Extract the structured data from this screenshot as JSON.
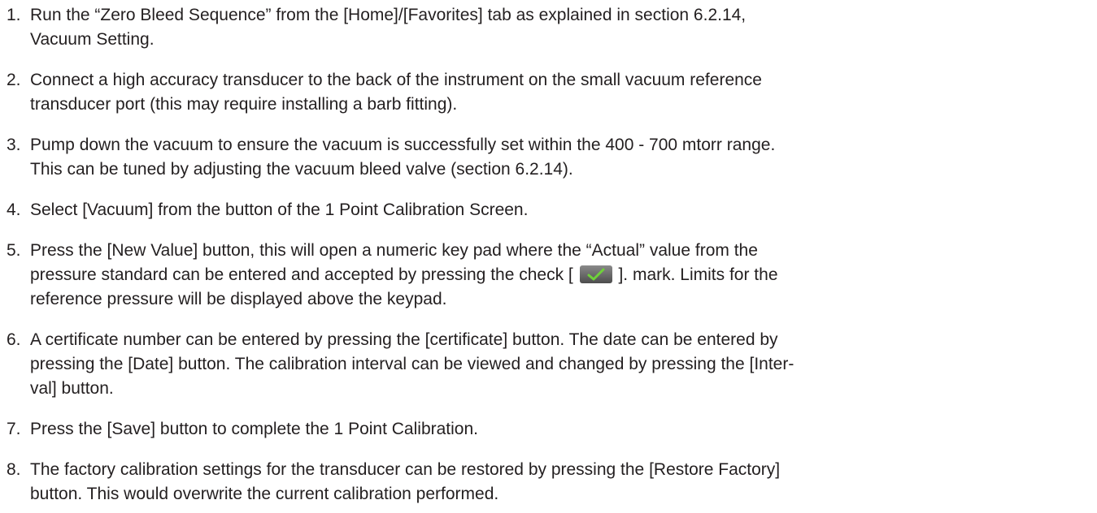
{
  "steps": [
    {
      "number": "1.",
      "lines": [
        "Run the “Zero Bleed Sequence” from the [Home]/[Favorites] tab as explained in section 6.2.14,",
        "Vacuum Setting."
      ]
    },
    {
      "number": "2.",
      "lines": [
        "Connect a high accuracy transducer to the back of the instrument on the small vacuum reference",
        "transducer port (this may require installing a barb fitting)."
      ]
    },
    {
      "number": "3.",
      "lines": [
        "Pump down the vacuum to ensure the vacuum is successfully set within the 400 - 700 mtorr range.",
        "This can be tuned by adjusting the vacuum bleed valve (section 6.2.14)."
      ]
    },
    {
      "number": "4.",
      "lines": [
        "Select [Vacuum] from the button of the 1 Point Calibration Screen."
      ]
    },
    {
      "number": "5.",
      "line1": "Press the [New Value] button, this will open a numeric key pad where the “Actual” value from the",
      "line2_before": "pressure standard can be entered and accepted by pressing the check [",
      "line2_after": "]. mark. Limits for the",
      "line3": "reference pressure will be displayed above the keypad."
    },
    {
      "number": "6.",
      "lines": [
        "A certificate number can be entered by pressing the [certificate] button. The date can be entered by",
        "pressing the [Date] button. The calibration interval can be viewed and changed by pressing the [Inter-",
        "val] button."
      ]
    },
    {
      "number": "7.",
      "lines": [
        "Press the [Save] button to complete the 1 Point Calibration."
      ]
    },
    {
      "number": "8.",
      "lines": [
        "The factory calibration settings for the transducer can be restored by pressing the [Restore Factory]",
        "button. This would overwrite the current calibration performed."
      ]
    }
  ],
  "icons": {
    "check": "checkmark-icon",
    "check_color": "#6fd13a",
    "check_bg": "#5a5a5a"
  }
}
